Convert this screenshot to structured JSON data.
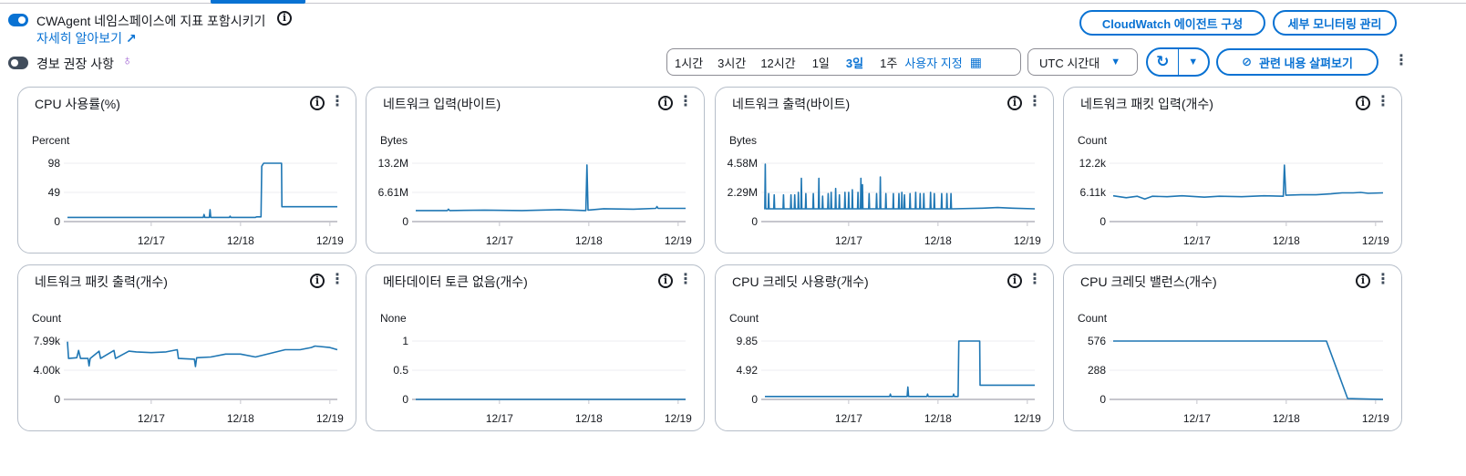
{
  "header": {
    "cwagent_toggle_label": "CWAgent 네임스페이스에 지표 포함시키기",
    "learn_more": "자세히 알아보기",
    "alarm_toggle_label": "경보 권장 사항",
    "cw_agent_button": "CloudWatch 에이전트 구성",
    "detail_monitoring_button": "세부 모니터링 관리",
    "time_ranges": [
      "1시간",
      "3시간",
      "12시간",
      "1일",
      "3일",
      "1주"
    ],
    "selected_range": "3일",
    "custom_range": "사용자 지정",
    "timezone": "UTC 시간대",
    "explore_button": "관련 내용 살펴보기"
  },
  "colors": {
    "accent": "#0972d3",
    "line": "#1f77b4"
  },
  "x_axis": {
    "domain_hours": [
      1.5,
      74
    ],
    "ticks": [
      {
        "h": 24,
        "label": "12/17"
      },
      {
        "h": 48,
        "label": "12/18"
      },
      {
        "h": 72,
        "label": "12/19"
      }
    ]
  },
  "chart_data": [
    {
      "type": "line",
      "title": "CPU 사용률(%)",
      "ylabel": "Percent",
      "ylim": [
        0,
        98
      ],
      "yticks": [
        "0",
        "49",
        "98"
      ],
      "points": [
        [
          1.5,
          7
        ],
        [
          38,
          7
        ],
        [
          38.2,
          12
        ],
        [
          38.4,
          7
        ],
        [
          39.6,
          7
        ],
        [
          39.8,
          20
        ],
        [
          40,
          7
        ],
        [
          45,
          7
        ],
        [
          45.2,
          9
        ],
        [
          45.4,
          7
        ],
        [
          52,
          7
        ],
        [
          52.3,
          8
        ],
        [
          53.5,
          8
        ],
        [
          53.7,
          93
        ],
        [
          54.2,
          98
        ],
        [
          59,
          98
        ],
        [
          59.1,
          25
        ],
        [
          74,
          25
        ]
      ]
    },
    {
      "type": "line",
      "title": "네트워크 입력(바이트)",
      "ylabel": "Bytes",
      "ylim": [
        0,
        13200000
      ],
      "yticks": [
        "0",
        "6.61M",
        "13.2M"
      ],
      "points": [
        [
          1.5,
          2500000
        ],
        [
          10,
          2500000
        ],
        [
          10.3,
          2800000
        ],
        [
          10.6,
          2500000
        ],
        [
          20,
          2600000
        ],
        [
          30,
          2500000
        ],
        [
          40,
          2700000
        ],
        [
          47.2,
          2500000
        ],
        [
          47.5,
          12800000
        ],
        [
          47.8,
          2600000
        ],
        [
          52,
          2900000
        ],
        [
          60,
          2800000
        ],
        [
          66,
          3000000
        ],
        [
          66.3,
          3400000
        ],
        [
          66.6,
          3000000
        ],
        [
          74,
          3000000
        ]
      ]
    },
    {
      "type": "line",
      "title": "네트워크 출력(바이트)",
      "ylabel": "Bytes",
      "ylim": [
        0,
        4580000
      ],
      "yticks": [
        "0",
        "2.29M",
        "4.58M"
      ],
      "baseline": 1000000,
      "baseline_end": 52,
      "tail": [
        [
          52,
          1000000
        ],
        [
          60,
          1050000
        ],
        [
          64,
          1100000
        ],
        [
          68,
          1050000
        ],
        [
          74,
          1000000
        ]
      ],
      "spikes": [
        [
          1.6,
          4500000
        ],
        [
          2.5,
          2200000
        ],
        [
          4,
          2100000
        ],
        [
          6.5,
          2100000
        ],
        [
          8.5,
          2100000
        ],
        [
          9.5,
          2100000
        ],
        [
          10.5,
          2300000
        ],
        [
          11.3,
          3400000
        ],
        [
          12.5,
          2200000
        ],
        [
          14.5,
          2200000
        ],
        [
          16,
          3400000
        ],
        [
          17,
          2000000
        ],
        [
          18.5,
          2200000
        ],
        [
          19.3,
          2300000
        ],
        [
          20.5,
          2600000
        ],
        [
          21.5,
          2100000
        ],
        [
          23,
          2300000
        ],
        [
          24,
          2300000
        ],
        [
          25,
          2500000
        ],
        [
          26.5,
          2300000
        ],
        [
          27.3,
          3400000
        ],
        [
          27.7,
          2900000
        ],
        [
          29.5,
          2200000
        ],
        [
          31.5,
          2200000
        ],
        [
          32.5,
          3500000
        ],
        [
          34,
          2200000
        ],
        [
          36,
          2200000
        ],
        [
          37.5,
          2200000
        ],
        [
          38.3,
          2300000
        ],
        [
          39,
          2100000
        ],
        [
          40.5,
          2200000
        ],
        [
          42,
          2300000
        ],
        [
          43.2,
          2200000
        ],
        [
          44.2,
          2200000
        ],
        [
          46,
          2300000
        ],
        [
          47,
          2200000
        ],
        [
          49,
          2200000
        ],
        [
          50.4,
          2200000
        ],
        [
          51.5,
          2200000
        ]
      ]
    },
    {
      "type": "line",
      "title": "네트워크 패킷 입력(개수)",
      "ylabel": "Count",
      "ylim": [
        0,
        12200
      ],
      "yticks": [
        "0",
        "6.11k",
        "12.2k"
      ],
      "points": [
        [
          1.5,
          5400
        ],
        [
          5,
          5000
        ],
        [
          8,
          5300
        ],
        [
          10,
          4700
        ],
        [
          12,
          5300
        ],
        [
          16,
          5200
        ],
        [
          20,
          5400
        ],
        [
          26,
          5100
        ],
        [
          30,
          5300
        ],
        [
          36,
          5200
        ],
        [
          42,
          5400
        ],
        [
          47.2,
          5300
        ],
        [
          47.5,
          11800
        ],
        [
          47.9,
          5500
        ],
        [
          52,
          5600
        ],
        [
          56,
          5600
        ],
        [
          60,
          5800
        ],
        [
          63,
          6000
        ],
        [
          66,
          6000
        ],
        [
          68,
          6100
        ],
        [
          70,
          5900
        ],
        [
          74,
          6000
        ]
      ]
    },
    {
      "type": "line",
      "title": "네트워크 패킷 출력(개수)",
      "ylabel": "Count",
      "ylim": [
        0,
        7990
      ],
      "yticks": [
        "0",
        "4.00k",
        "7.99k"
      ],
      "points": [
        [
          1.5,
          7900
        ],
        [
          1.8,
          5600
        ],
        [
          4,
          5700
        ],
        [
          4.5,
          6700
        ],
        [
          5,
          5600
        ],
        [
          7,
          5600
        ],
        [
          7.3,
          4600
        ],
        [
          7.6,
          5600
        ],
        [
          10,
          6600
        ],
        [
          10.4,
          5600
        ],
        [
          14,
          6700
        ],
        [
          14.4,
          5600
        ],
        [
          18,
          6600
        ],
        [
          20,
          6500
        ],
        [
          24,
          6400
        ],
        [
          28,
          6500
        ],
        [
          31,
          6800
        ],
        [
          31.3,
          5600
        ],
        [
          35.6,
          5500
        ],
        [
          35.9,
          4500
        ],
        [
          36.2,
          5700
        ],
        [
          40,
          5800
        ],
        [
          44,
          6200
        ],
        [
          48,
          6200
        ],
        [
          52,
          5800
        ],
        [
          56,
          6300
        ],
        [
          60,
          6800
        ],
        [
          64,
          6800
        ],
        [
          67,
          7100
        ],
        [
          68,
          7300
        ],
        [
          72,
          7100
        ],
        [
          74,
          6800
        ]
      ]
    },
    {
      "type": "line",
      "title": "메타데이터 토큰 없음(개수)",
      "ylabel": "None",
      "ylim": [
        0,
        1
      ],
      "yticks": [
        "0",
        "0.5",
        "1"
      ],
      "points": [
        [
          1.5,
          0
        ],
        [
          74,
          0
        ]
      ]
    },
    {
      "type": "line",
      "title": "CPU 크레딧 사용량(개수)",
      "ylabel": "Count",
      "ylim": [
        0,
        9.85
      ],
      "yticks": [
        "0",
        "4.92",
        "9.85"
      ],
      "points": [
        [
          1.5,
          0.5
        ],
        [
          35,
          0.5
        ],
        [
          35.2,
          0.9
        ],
        [
          35.4,
          0.5
        ],
        [
          39.7,
          0.5
        ],
        [
          39.9,
          2.1
        ],
        [
          40.1,
          0.5
        ],
        [
          45,
          0.5
        ],
        [
          45.2,
          0.9
        ],
        [
          45.4,
          0.5
        ],
        [
          52,
          0.5
        ],
        [
          52.2,
          0.9
        ],
        [
          52.4,
          0.5
        ],
        [
          53.4,
          0.5
        ],
        [
          53.6,
          9.85
        ],
        [
          59.2,
          9.85
        ],
        [
          59.3,
          2.4
        ],
        [
          74,
          2.4
        ]
      ]
    },
    {
      "type": "line",
      "title": "CPU 크레딧 밸런스(개수)",
      "ylabel": "Count",
      "ylim": [
        0,
        576
      ],
      "yticks": [
        "0",
        "288",
        "576"
      ],
      "points": [
        [
          1.5,
          576
        ],
        [
          58.8,
          576
        ],
        [
          64.5,
          8
        ],
        [
          74,
          0
        ]
      ]
    }
  ]
}
